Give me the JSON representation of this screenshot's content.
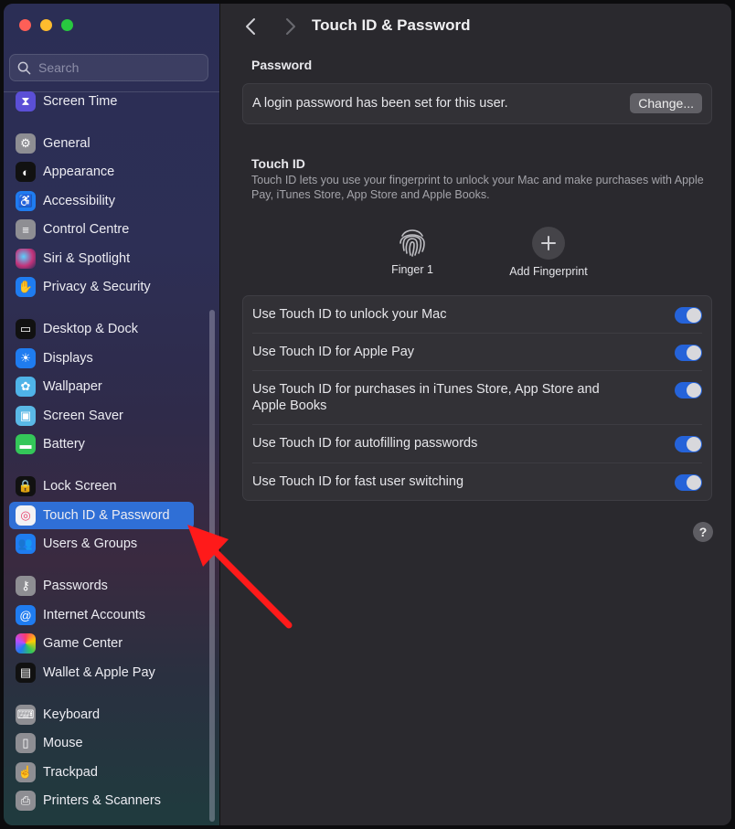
{
  "window": {
    "title": "Touch ID & Password"
  },
  "sidebar": {
    "search_placeholder": "Search",
    "items": [
      {
        "label": "Screen Time",
        "icon": "hourglass-icon",
        "color": "#5b4fd6"
      },
      {
        "label": "General",
        "icon": "gear-icon",
        "color": "#8e8e93"
      },
      {
        "label": "Appearance",
        "icon": "appearance-icon",
        "color": "#111111"
      },
      {
        "label": "Accessibility",
        "icon": "accessibility-icon",
        "color": "#1f7cf0"
      },
      {
        "label": "Control Centre",
        "icon": "toggles-icon",
        "color": "#8e8e93"
      },
      {
        "label": "Siri & Spotlight",
        "icon": "siri-icon",
        "color": "#8a2d6a"
      },
      {
        "label": "Privacy & Security",
        "icon": "hand-icon",
        "color": "#1f7cf0"
      },
      {
        "label": "Desktop & Dock",
        "icon": "dock-icon",
        "color": "#111111"
      },
      {
        "label": "Displays",
        "icon": "sun-icon",
        "color": "#1f7cf0"
      },
      {
        "label": "Wallpaper",
        "icon": "flower-icon",
        "color": "#4fb3e8"
      },
      {
        "label": "Screen Saver",
        "icon": "screensaver-icon",
        "color": "#5ab8e6"
      },
      {
        "label": "Battery",
        "icon": "battery-icon",
        "color": "#34c759"
      },
      {
        "label": "Lock Screen",
        "icon": "lock-icon",
        "color": "#111111"
      },
      {
        "label": "Touch ID & Password",
        "icon": "fingerprint-icon",
        "color": "#f2f2f4",
        "selected": true
      },
      {
        "label": "Users & Groups",
        "icon": "users-icon",
        "color": "#1f7cf0"
      },
      {
        "label": "Passwords",
        "icon": "key-icon",
        "color": "#8e8e93"
      },
      {
        "label": "Internet Accounts",
        "icon": "at-icon",
        "color": "#1f7cf0"
      },
      {
        "label": "Game Center",
        "icon": "game-center-icon",
        "color": "#ffffff"
      },
      {
        "label": "Wallet & Apple Pay",
        "icon": "wallet-icon",
        "color": "#111111"
      },
      {
        "label": "Keyboard",
        "icon": "keyboard-icon",
        "color": "#8e8e93"
      },
      {
        "label": "Mouse",
        "icon": "mouse-icon",
        "color": "#8e8e93"
      },
      {
        "label": "Trackpad",
        "icon": "trackpad-icon",
        "color": "#8e8e93"
      },
      {
        "label": "Printers & Scanners",
        "icon": "printer-icon",
        "color": "#8e8e93"
      }
    ]
  },
  "main": {
    "title": "Touch ID & Password",
    "password_section": {
      "heading": "Password",
      "status_text": "A login password has been set for this user.",
      "change_label": "Change..."
    },
    "touchid_section": {
      "heading": "Touch ID",
      "description": "Touch ID lets you use your fingerprint to unlock your Mac and make purchases with Apple Pay, iTunes Store, App Store and Apple Books.",
      "fingers": [
        {
          "label": "Finger 1"
        }
      ],
      "add_label": "Add Fingerprint"
    },
    "toggles": [
      {
        "label": "Use Touch ID to unlock your Mac",
        "on": true
      },
      {
        "label": "Use Touch ID for Apple Pay",
        "on": true
      },
      {
        "label": "Use Touch ID for purchases in iTunes Store, App Store and Apple Books",
        "on": true
      },
      {
        "label": "Use Touch ID for autofilling passwords",
        "on": true
      },
      {
        "label": "Use Touch ID for fast user switching",
        "on": true
      }
    ],
    "help_label": "?"
  },
  "colors": {
    "accent": "#2563d9",
    "selection": "#2f6fd6",
    "annotation_arrow": "#ff1a1a"
  }
}
